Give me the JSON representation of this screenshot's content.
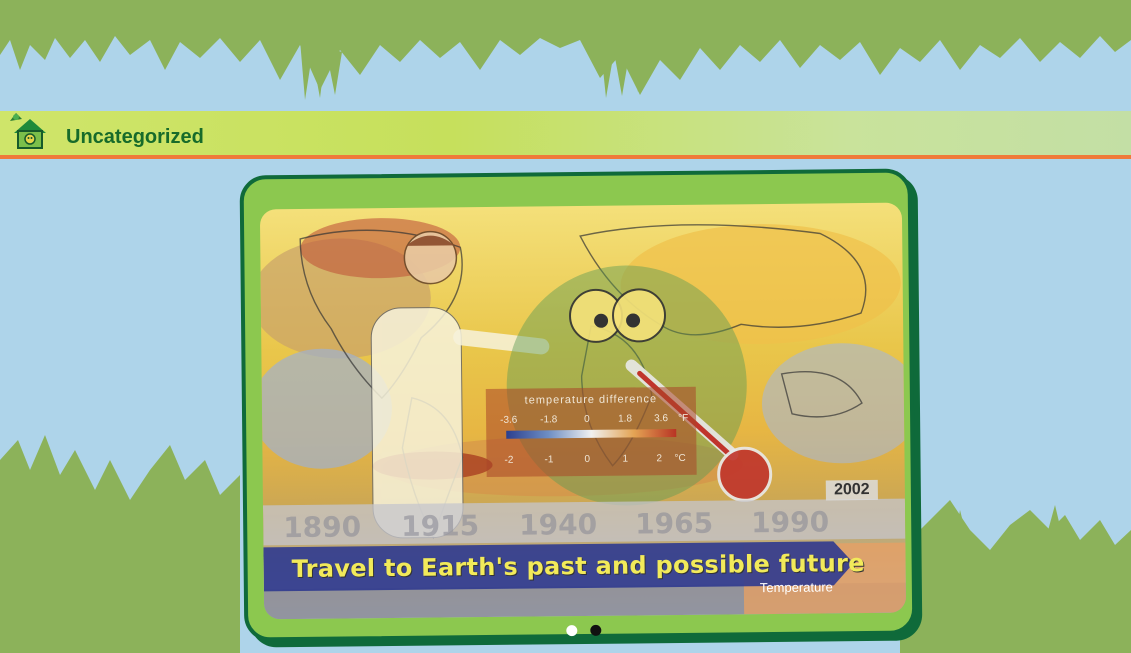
{
  "category": {
    "title": "Uncategorized",
    "icon": "house-icon"
  },
  "slider": {
    "caption": "Travel to Earth's past and possible future",
    "year": "2002",
    "timeline_years": [
      "1890",
      "1915",
      "1940",
      "1965",
      "1990"
    ],
    "legend": {
      "title": "temperature difference",
      "fahrenheit_ticks": [
        "-3.6",
        "-1.8",
        "0",
        "1.8",
        "3.6"
      ],
      "fahrenheit_unit": "°F",
      "celsius_ticks": [
        "-2",
        "-1",
        "0",
        "1",
        "2"
      ],
      "celsius_unit": "°C"
    },
    "next_slide_peek": "Temperature",
    "pagination": {
      "count": 2,
      "active_index": 1
    }
  },
  "colors": {
    "sky": "#aed4ea",
    "foliage": "#8cb25a",
    "frame_green": "#8cc84f",
    "frame_border": "#0f6a3a",
    "category_text": "#176b2a",
    "accent_line": "#ef7a3a",
    "caption_banner": "#2f3a8f",
    "caption_text": "#f2ea5a"
  }
}
